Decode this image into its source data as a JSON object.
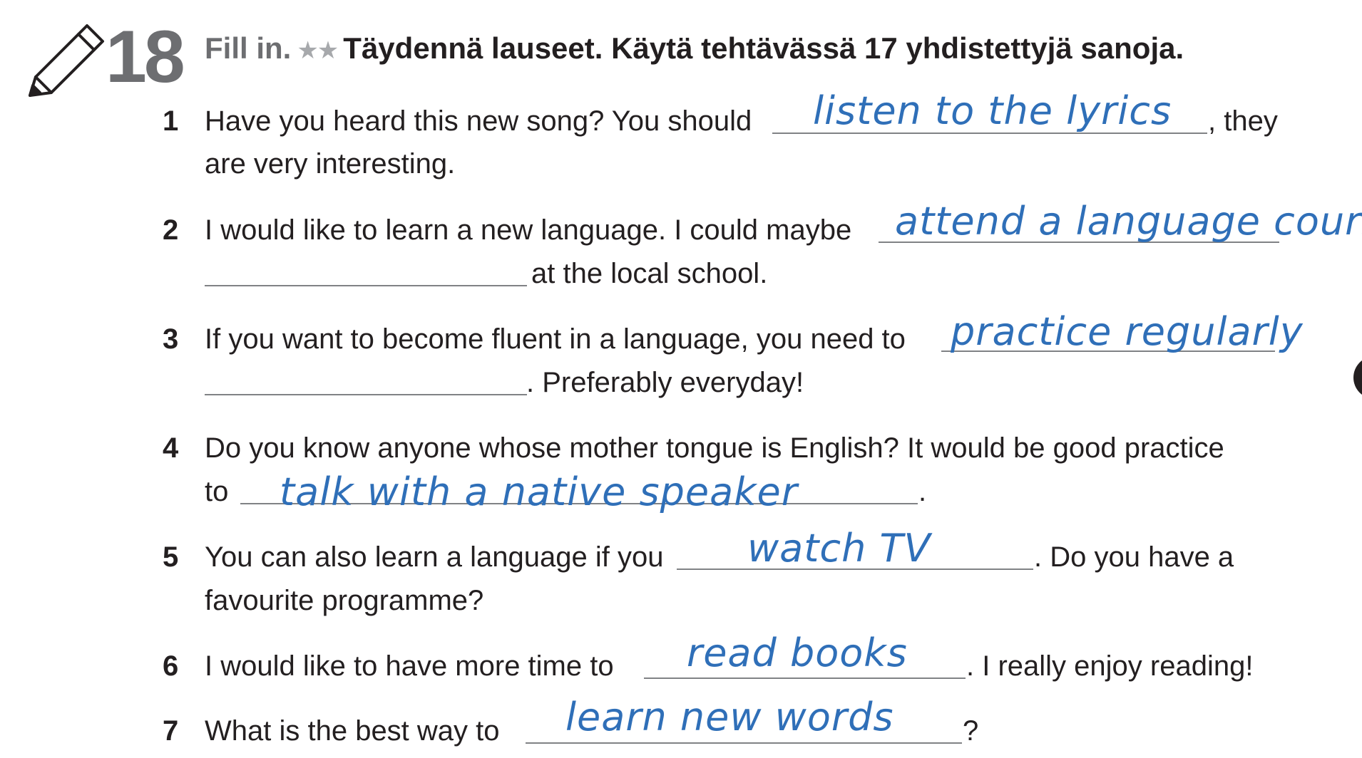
{
  "exercise": {
    "number": "18",
    "instruction_en": "Fill in.",
    "stars": "★★",
    "instruction_fi": "Täydennä lauseet. Käytä tehtävässä 17 yhdistettyjä sanoja."
  },
  "items": [
    {
      "num": "1",
      "before": "Have you heard this new song? You should",
      "answer": "listen to the lyrics",
      "after": ", they",
      "line2": "are very interesting."
    },
    {
      "num": "2",
      "before": "I would like to learn a new language. I could maybe",
      "answer": "attend a language course",
      "after": "",
      "line2": "at the local school."
    },
    {
      "num": "3",
      "before": "If you want to become fluent in a language, you need to",
      "answer": "practice regularly",
      "after": "",
      "line2": ". Preferably everyday!"
    },
    {
      "num": "4",
      "before": "Do you know anyone whose mother tongue is English? It would be good practice",
      "line2_before": "to",
      "answer": "talk with a native speaker",
      "after": "."
    },
    {
      "num": "5",
      "before": "You can also learn a language if you",
      "answer": "watch TV",
      "after": ". Do you have a",
      "line2": "favourite programme?"
    },
    {
      "num": "6",
      "before": "I would like to have more time to",
      "answer": "read books",
      "after": ". I really enjoy reading!"
    },
    {
      "num": "7",
      "before": "What is the best way to",
      "answer": "learn new words",
      "after": "?"
    }
  ],
  "colors": {
    "handwriting": "#2f6fb8",
    "heading_grey": "#6d6e71",
    "text": "#231f20",
    "rule": "#808285"
  }
}
